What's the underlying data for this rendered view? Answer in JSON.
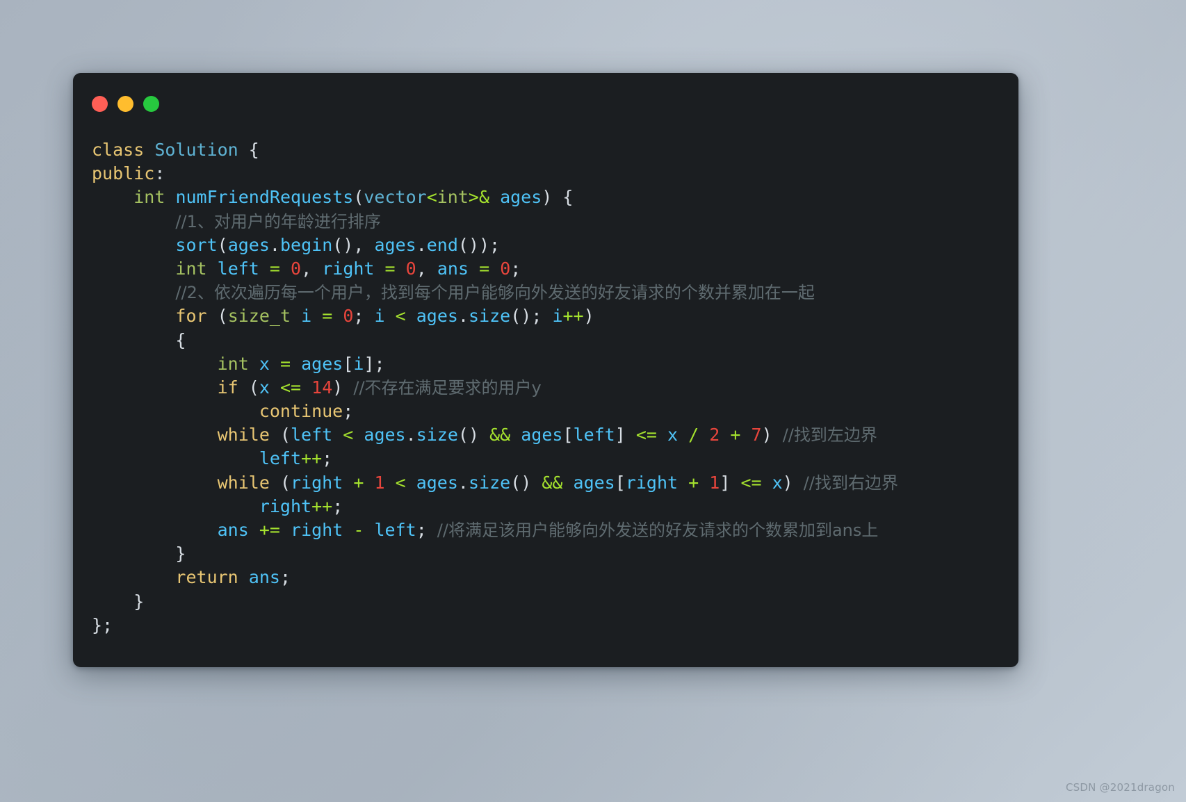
{
  "window": {
    "traffic_lights": [
      {
        "name": "close",
        "color": "#ff5f56"
      },
      {
        "name": "minimize",
        "color": "#ffbd2e"
      },
      {
        "name": "maximize",
        "color": "#27c93f"
      }
    ]
  },
  "theme": {
    "background_gradient_from": "#a9b3bf",
    "background_gradient_to": "#c2ccd6",
    "card_background": "#1b1e21",
    "keyword": "#e8c673",
    "type": "#a5c261",
    "class_name": "#5fb3d4",
    "function": "#4fc3f7",
    "identifier": "#4fc3f7",
    "number": "#e8453c",
    "operator": "#a5e22e",
    "punctuation": "#d8dee4",
    "comment": "#5f6b70"
  },
  "code": {
    "language": "cpp",
    "lines": [
      "class Solution {",
      "public:",
      "    int numFriendRequests(vector<int>& ages) {",
      "        //1、对用户的年龄进行排序",
      "        sort(ages.begin(), ages.end());",
      "        int left = 0, right = 0, ans = 0;",
      "        //2、依次遍历每一个用户，找到每个用户能够向外发送的好友请求的个数并累加在一起",
      "        for (size_t i = 0; i < ages.size(); i++)",
      "        {",
      "            int x = ages[i];",
      "            if (x <= 14) //不存在满足要求的用户y",
      "                continue;",
      "            while (left < ages.size() && ages[left] <= x / 2 + 7) //找到左边界",
      "                left++;",
      "            while (right + 1 < ages.size() && ages[right + 1] <= x) //找到右边界",
      "                right++;",
      "            ans += right - left; //将满足该用户能够向外发送的好友请求的个数累加到ans上",
      "        }",
      "        return ans;",
      "    }",
      "};"
    ],
    "tokens": {
      "l0": [
        [
          "kw",
          "class"
        ],
        [
          "pun",
          " "
        ],
        [
          "cls",
          "Solution"
        ],
        [
          "pun",
          " {"
        ]
      ],
      "l1": [
        [
          "kw",
          "public"
        ],
        [
          "pun",
          ":"
        ]
      ],
      "l2": [
        [
          "pun",
          "    "
        ],
        [
          "typ",
          "int"
        ],
        [
          "pun",
          " "
        ],
        [
          "fn",
          "numFriendRequests"
        ],
        [
          "pun",
          "("
        ],
        [
          "cls",
          "vector"
        ],
        [
          "op",
          "<"
        ],
        [
          "typ",
          "int"
        ],
        [
          "op",
          ">&"
        ],
        [
          "pun",
          " "
        ],
        [
          "id",
          "ages"
        ],
        [
          "pun",
          ") {"
        ]
      ],
      "l3": [
        [
          "pun",
          "        "
        ],
        [
          "cmt",
          "//1、对用户的年龄进行排序"
        ]
      ],
      "l4": [
        [
          "pun",
          "        "
        ],
        [
          "fn",
          "sort"
        ],
        [
          "pun",
          "("
        ],
        [
          "id",
          "ages"
        ],
        [
          "pun",
          "."
        ],
        [
          "fn",
          "begin"
        ],
        [
          "pun",
          "(), "
        ],
        [
          "id",
          "ages"
        ],
        [
          "pun",
          "."
        ],
        [
          "fn",
          "end"
        ],
        [
          "pun",
          "());"
        ]
      ],
      "l5": [
        [
          "pun",
          "        "
        ],
        [
          "typ",
          "int"
        ],
        [
          "pun",
          " "
        ],
        [
          "id",
          "left"
        ],
        [
          "pun",
          " "
        ],
        [
          "op",
          "="
        ],
        [
          "pun",
          " "
        ],
        [
          "num",
          "0"
        ],
        [
          "pun",
          ", "
        ],
        [
          "id",
          "right"
        ],
        [
          "pun",
          " "
        ],
        [
          "op",
          "="
        ],
        [
          "pun",
          " "
        ],
        [
          "num",
          "0"
        ],
        [
          "pun",
          ", "
        ],
        [
          "id",
          "ans"
        ],
        [
          "pun",
          " "
        ],
        [
          "op",
          "="
        ],
        [
          "pun",
          " "
        ],
        [
          "num",
          "0"
        ],
        [
          "pun",
          ";"
        ]
      ],
      "l6": [
        [
          "pun",
          "        "
        ],
        [
          "cmt",
          "//2、依次遍历每一个用户，找到每个用户能够向外发送的好友请求的个数并累加在一起"
        ]
      ],
      "l7": [
        [
          "pun",
          "        "
        ],
        [
          "kw",
          "for"
        ],
        [
          "pun",
          " ("
        ],
        [
          "typ",
          "size_t"
        ],
        [
          "pun",
          " "
        ],
        [
          "id",
          "i"
        ],
        [
          "pun",
          " "
        ],
        [
          "op",
          "="
        ],
        [
          "pun",
          " "
        ],
        [
          "num",
          "0"
        ],
        [
          "pun",
          "; "
        ],
        [
          "id",
          "i"
        ],
        [
          "pun",
          " "
        ],
        [
          "op",
          "<"
        ],
        [
          "pun",
          " "
        ],
        [
          "id",
          "ages"
        ],
        [
          "pun",
          "."
        ],
        [
          "fn",
          "size"
        ],
        [
          "pun",
          "(); "
        ],
        [
          "id",
          "i"
        ],
        [
          "op",
          "++"
        ],
        [
          "pun",
          ")"
        ]
      ],
      "l8": [
        [
          "pun",
          "        {"
        ]
      ],
      "l9": [
        [
          "pun",
          "            "
        ],
        [
          "typ",
          "int"
        ],
        [
          "pun",
          " "
        ],
        [
          "id",
          "x"
        ],
        [
          "pun",
          " "
        ],
        [
          "op",
          "="
        ],
        [
          "pun",
          " "
        ],
        [
          "id",
          "ages"
        ],
        [
          "pun",
          "["
        ],
        [
          "id",
          "i"
        ],
        [
          "pun",
          "];"
        ]
      ],
      "l10": [
        [
          "pun",
          "            "
        ],
        [
          "kw",
          "if"
        ],
        [
          "pun",
          " ("
        ],
        [
          "id",
          "x"
        ],
        [
          "pun",
          " "
        ],
        [
          "op",
          "<="
        ],
        [
          "pun",
          " "
        ],
        [
          "num",
          "14"
        ],
        [
          "pun",
          ") "
        ],
        [
          "cmt",
          "//不存在满足要求的用户y"
        ]
      ],
      "l11": [
        [
          "pun",
          "                "
        ],
        [
          "kw",
          "continue"
        ],
        [
          "pun",
          ";"
        ]
      ],
      "l12": [
        [
          "pun",
          "            "
        ],
        [
          "kw",
          "while"
        ],
        [
          "pun",
          " ("
        ],
        [
          "id",
          "left"
        ],
        [
          "pun",
          " "
        ],
        [
          "op",
          "<"
        ],
        [
          "pun",
          " "
        ],
        [
          "id",
          "ages"
        ],
        [
          "pun",
          "."
        ],
        [
          "fn",
          "size"
        ],
        [
          "pun",
          "() "
        ],
        [
          "op",
          "&&"
        ],
        [
          "pun",
          " "
        ],
        [
          "id",
          "ages"
        ],
        [
          "pun",
          "["
        ],
        [
          "id",
          "left"
        ],
        [
          "pun",
          "] "
        ],
        [
          "op",
          "<="
        ],
        [
          "pun",
          " "
        ],
        [
          "id",
          "x"
        ],
        [
          "pun",
          " "
        ],
        [
          "op",
          "/"
        ],
        [
          "pun",
          " "
        ],
        [
          "num",
          "2"
        ],
        [
          "pun",
          " "
        ],
        [
          "op",
          "+"
        ],
        [
          "pun",
          " "
        ],
        [
          "num",
          "7"
        ],
        [
          "pun",
          ") "
        ],
        [
          "cmt",
          "//找到左边界"
        ]
      ],
      "l13": [
        [
          "pun",
          "                "
        ],
        [
          "id",
          "left"
        ],
        [
          "op",
          "++"
        ],
        [
          "pun",
          ";"
        ]
      ],
      "l14": [
        [
          "pun",
          "            "
        ],
        [
          "kw",
          "while"
        ],
        [
          "pun",
          " ("
        ],
        [
          "id",
          "right"
        ],
        [
          "pun",
          " "
        ],
        [
          "op",
          "+"
        ],
        [
          "pun",
          " "
        ],
        [
          "num",
          "1"
        ],
        [
          "pun",
          " "
        ],
        [
          "op",
          "<"
        ],
        [
          "pun",
          " "
        ],
        [
          "id",
          "ages"
        ],
        [
          "pun",
          "."
        ],
        [
          "fn",
          "size"
        ],
        [
          "pun",
          "() "
        ],
        [
          "op",
          "&&"
        ],
        [
          "pun",
          " "
        ],
        [
          "id",
          "ages"
        ],
        [
          "pun",
          "["
        ],
        [
          "id",
          "right"
        ],
        [
          "pun",
          " "
        ],
        [
          "op",
          "+"
        ],
        [
          "pun",
          " "
        ],
        [
          "num",
          "1"
        ],
        [
          "pun",
          "] "
        ],
        [
          "op",
          "<="
        ],
        [
          "pun",
          " "
        ],
        [
          "id",
          "x"
        ],
        [
          "pun",
          ") "
        ],
        [
          "cmt",
          "//找到右边界"
        ]
      ],
      "l15": [
        [
          "pun",
          "                "
        ],
        [
          "id",
          "right"
        ],
        [
          "op",
          "++"
        ],
        [
          "pun",
          ";"
        ]
      ],
      "l16": [
        [
          "pun",
          "            "
        ],
        [
          "id",
          "ans"
        ],
        [
          "pun",
          " "
        ],
        [
          "op",
          "+="
        ],
        [
          "pun",
          " "
        ],
        [
          "id",
          "right"
        ],
        [
          "pun",
          " "
        ],
        [
          "op",
          "-"
        ],
        [
          "pun",
          " "
        ],
        [
          "id",
          "left"
        ],
        [
          "pun",
          "; "
        ],
        [
          "cmt",
          "//将满足该用户能够向外发送的好友请求的个数累加到ans上"
        ]
      ],
      "l17": [
        [
          "pun",
          "        }"
        ]
      ],
      "l18": [
        [
          "pun",
          "        "
        ],
        [
          "kw",
          "return"
        ],
        [
          "pun",
          " "
        ],
        [
          "id",
          "ans"
        ],
        [
          "pun",
          ";"
        ]
      ],
      "l19": [
        [
          "pun",
          "    }"
        ]
      ],
      "l20": [
        [
          "pun",
          "};"
        ]
      ]
    }
  },
  "watermark": {
    "text": "CSDN @2021dragon"
  }
}
